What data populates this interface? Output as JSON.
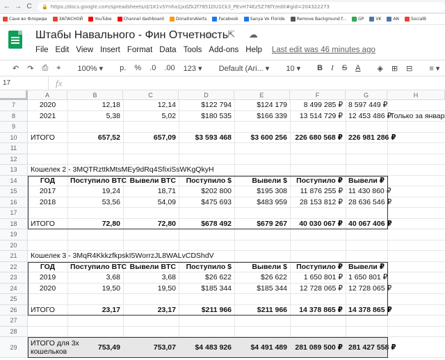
{
  "browser": {
    "back": "←",
    "forward": "→",
    "reload": "C",
    "url": "https://docs.google.com/spreadsheets/d/1K1vSYnha1jxdZk2f7851DU1Ck3_PEvH74Ez5Z76fY/edit#gid=204322273"
  },
  "bookmarks": [
    {
      "label": "Саня во Флориде",
      "color": "#ea4335"
    },
    {
      "label": "ЗАПАСНОЙ",
      "color": "#ea4335"
    },
    {
      "label": "YouTube",
      "color": "#ff0000"
    },
    {
      "label": "Channel dashboard",
      "color": "#ff0000"
    },
    {
      "label": "DonationAlerts",
      "color": "#f39c12"
    },
    {
      "label": "Facebook",
      "color": "#1877f2"
    },
    {
      "label": "Sanya Vo Floride",
      "color": "#1877f2"
    },
    {
      "label": "Remove Background f...",
      "color": "#555555"
    },
    {
      "label": "GP",
      "color": "#34a853"
    },
    {
      "label": "VK",
      "color": "#4a76a8"
    },
    {
      "label": "AN",
      "color": "#4a76a8"
    },
    {
      "label": "SocialB",
      "color": "#ea4335"
    }
  ],
  "doc": {
    "title": "Штабы Навального - Фин Отчетность",
    "title_icons": "☆ ⇱ ☁",
    "menu": [
      "File",
      "Edit",
      "View",
      "Insert",
      "Format",
      "Data",
      "Tools",
      "Add-ons",
      "Help"
    ],
    "last_edit": "Last edit was 46 minutes ago"
  },
  "toolbar": {
    "undo": "↶",
    "redo": "↷",
    "print": "⎙",
    "paint": "⌖",
    "zoom": "100% ▾",
    "currency": "р.",
    "percent": "%",
    "dec_less": ".0",
    "dec_more": ".00",
    "more_formats": "123 ▾",
    "font": "Default (Ari... ▾",
    "font_size": "10 ▾",
    "bold": "B",
    "italic": "I",
    "strike": "S",
    "text_color": "A",
    "fill": "◈",
    "borders": "⊞",
    "merge": "⊟",
    "align": "≡ ▾",
    "valign": "⊥ ▾"
  },
  "formula_bar": {
    "cell_ref": "17",
    "fx": "fx",
    "value": ""
  },
  "columns": [
    "A",
    "B",
    "C",
    "D",
    "E",
    "F",
    "G",
    "H"
  ],
  "rows": [
    {
      "num": "7",
      "cells": [
        "2020",
        "12,18",
        "12,14",
        "$122 794",
        "$124 179",
        "8 499 285 ₽",
        "8 597 449 ₽",
        ""
      ]
    },
    {
      "num": "8",
      "cells": [
        "2021",
        "5,38",
        "5,02",
        "$180 535",
        "$166 339",
        "13 514 729 ₽",
        "12 453 486 ₽",
        "Только за январь"
      ]
    },
    {
      "num": "9",
      "cells": [
        "",
        "",
        "",
        "",
        "",
        "",
        "",
        ""
      ]
    },
    {
      "num": "10",
      "cells": [
        "ИТОГО",
        "657,52",
        "657,09",
        "$3 593 468",
        "$3 600 256",
        "226 680 568 ₽",
        "226 981 286 ₽",
        ""
      ]
    },
    {
      "num": "11",
      "cells": [
        "",
        "",
        "",
        "",
        "",
        "",
        "",
        ""
      ]
    },
    {
      "num": "12",
      "cells": [
        "",
        "",
        "",
        "",
        "",
        "",
        "",
        ""
      ]
    },
    {
      "num": "13",
      "cells": [
        "Кошелек 2 - 3MQTRzttkMtsMEy9dRq4SfixiSsWKgQkyH",
        "",
        "",
        "",
        "",
        "",
        "",
        ""
      ]
    },
    {
      "num": "14",
      "cells": [
        "ГОД",
        "Поступило BTC",
        "Вывели BTC",
        "Поступило $",
        "Вывели $",
        "Поступило ₽",
        "Вывели ₽",
        ""
      ]
    },
    {
      "num": "15",
      "cells": [
        "2017",
        "19,24",
        "18,71",
        "$202 800",
        "$195 308",
        "11 876 255 ₽",
        "11 430 860 ₽",
        ""
      ]
    },
    {
      "num": "16",
      "cells": [
        "2018",
        "53,56",
        "54,09",
        "$475 693",
        "$483 959",
        "28 153 812 ₽",
        "28 636 546 ₽",
        ""
      ]
    },
    {
      "num": "17",
      "cells": [
        "",
        "",
        "",
        "",
        "",
        "",
        "",
        ""
      ]
    },
    {
      "num": "18",
      "cells": [
        "ИТОГО",
        "72,80",
        "72,80",
        "$678 492",
        "$679 267",
        "40 030 067 ₽",
        "40 067 406 ₽",
        ""
      ]
    },
    {
      "num": "19",
      "cells": [
        "",
        "",
        "",
        "",
        "",
        "",
        "",
        ""
      ]
    },
    {
      "num": "20",
      "cells": [
        "",
        "",
        "",
        "",
        "",
        "",
        "",
        ""
      ]
    },
    {
      "num": "21",
      "cells": [
        "Кошелек 3 - 3MqR4KkkzfkpskI5WorrzJL8WALvCDShdV",
        "",
        "",
        "",
        "",
        "",
        "",
        ""
      ]
    },
    {
      "num": "22",
      "cells": [
        "ГОД",
        "Поступило BTC",
        "Вывели BTC",
        "Поступило $",
        "Вывели $",
        "Поступило ₽",
        "Вывели ₽",
        ""
      ]
    },
    {
      "num": "23",
      "cells": [
        "2019",
        "3,68",
        "3,68",
        "$26 622",
        "$26 622",
        "1 650 801 ₽",
        "1 650 801 ₽",
        ""
      ]
    },
    {
      "num": "24",
      "cells": [
        "2020",
        "19,50",
        "19,50",
        "$185 344",
        "$185 344",
        "12 728 065 ₽",
        "12 728 065 ₽",
        ""
      ]
    },
    {
      "num": "25",
      "cells": [
        "",
        "",
        "",
        "",
        "",
        "",
        "",
        ""
      ]
    },
    {
      "num": "26",
      "cells": [
        "ИТОГО",
        "23,17",
        "23,17",
        "$211 966",
        "$211 966",
        "14 378 865 ₽",
        "14 378 865 ₽",
        ""
      ]
    },
    {
      "num": "27",
      "cells": [
        "",
        "",
        "",
        "",
        "",
        "",
        "",
        ""
      ]
    },
    {
      "num": "28",
      "cells": [
        "",
        "",
        "",
        "",
        "",
        "",
        "",
        ""
      ]
    },
    {
      "num": "29",
      "cells": [
        "ИТОГО для 3х\nкошельков",
        "753,49",
        "753,07",
        "$4 483 926",
        "$4 491 489",
        "281 089 500 ₽",
        "281 427 558 ₽",
        ""
      ]
    }
  ]
}
